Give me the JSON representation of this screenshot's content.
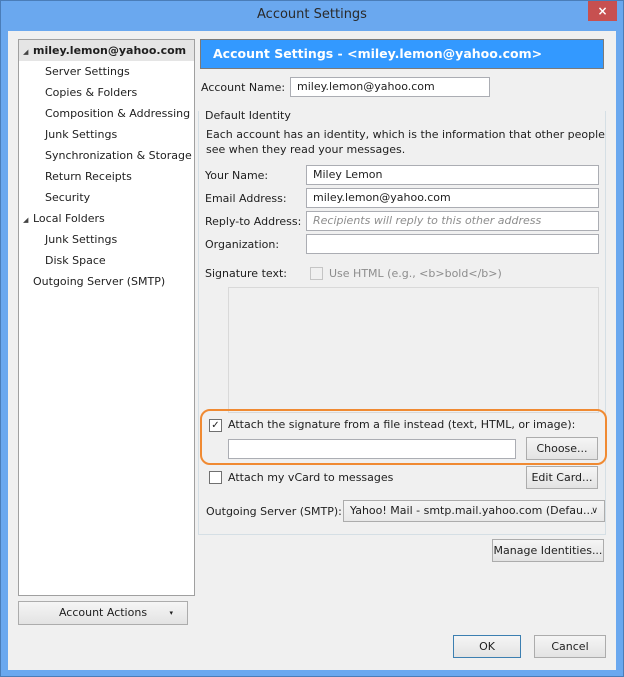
{
  "window": {
    "title": "Account Settings",
    "close_label": "×"
  },
  "sidebar": {
    "items": [
      {
        "label": "miley.lemon@yahoo.com",
        "level": 0,
        "expanded": true,
        "selected": true
      },
      {
        "label": "Server Settings",
        "level": 1
      },
      {
        "label": "Copies & Folders",
        "level": 1
      },
      {
        "label": "Composition & Addressing",
        "level": 1
      },
      {
        "label": "Junk Settings",
        "level": 1
      },
      {
        "label": "Synchronization & Storage",
        "level": 1
      },
      {
        "label": "Return Receipts",
        "level": 1
      },
      {
        "label": "Security",
        "level": 1
      },
      {
        "label": "Local Folders",
        "level": 0,
        "expanded": true
      },
      {
        "label": "Junk Settings",
        "level": 1
      },
      {
        "label": "Disk Space",
        "level": 1
      },
      {
        "label": "Outgoing Server (SMTP)",
        "level": 0
      }
    ],
    "account_actions_label": "Account Actions",
    "dropdown_arrow": "▾"
  },
  "main": {
    "header": "Account Settings - <miley.lemon@yahoo.com>",
    "account_name_label": "Account Name:",
    "account_name_value": "miley.lemon@yahoo.com",
    "group_title": "Default Identity",
    "description": "Each account has an identity, which is the information that other people see when they read your messages.",
    "your_name_label": "Your Name:",
    "your_name_value": "Miley Lemon",
    "email_label": "Email Address:",
    "email_value": "miley.lemon@yahoo.com",
    "reply_to_label": "Reply-to Address:",
    "reply_to_placeholder": "Recipients will reply to this other address",
    "organization_label": "Organization:",
    "organization_value": "",
    "signature_label": "Signature text:",
    "use_html_label": "Use HTML (e.g., <b>bold</b>)",
    "use_html_checked": false,
    "attach_sig_label": "Attach the signature from a file instead (text, HTML, or image):",
    "attach_sig_checked": true,
    "attach_sig_path": "",
    "choose_label": "Choose...",
    "vcard_label": "Attach my vCard to messages",
    "vcard_checked": false,
    "edit_card_label": "Edit Card...",
    "smtp_label": "Outgoing Server (SMTP):",
    "smtp_value": "Yahoo! Mail - smtp.mail.yahoo.com (Defau...",
    "manage_identities_label": "Manage Identities...",
    "checkmark": "✓",
    "chevron": "∨"
  },
  "footer": {
    "ok_label": "OK",
    "cancel_label": "Cancel"
  },
  "colors": {
    "accent": "#3399ff",
    "titlebar": "#6aa8ef",
    "highlight": "#f08a32",
    "close": "#c75050"
  }
}
